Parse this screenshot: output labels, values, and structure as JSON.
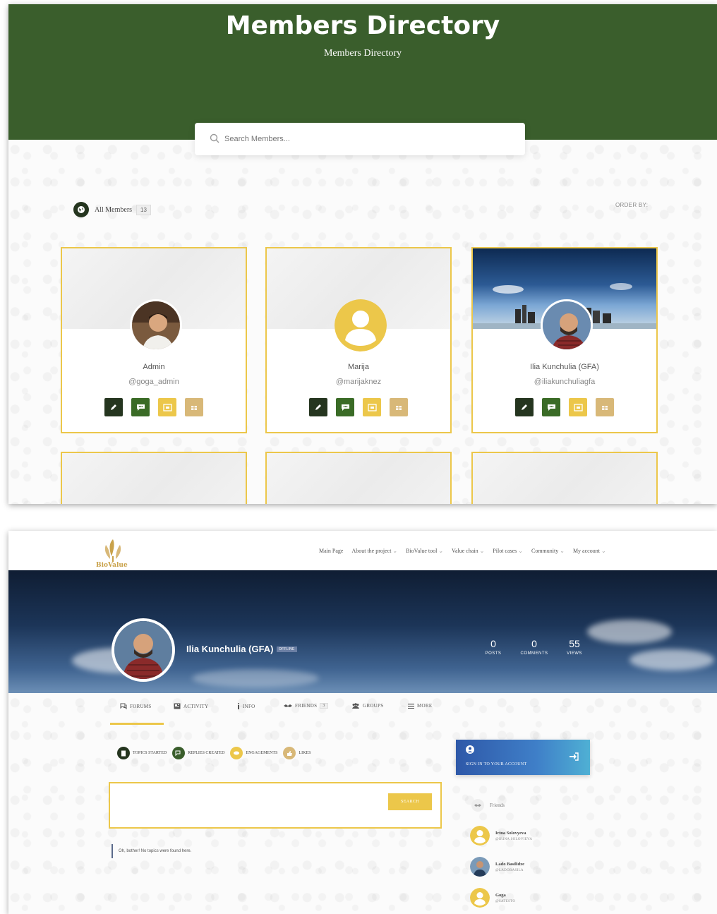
{
  "directory": {
    "title": "Members Directory",
    "subtitle": "Members Directory",
    "search_placeholder": "Search Members...",
    "all_members_label": "All Members",
    "all_members_count": "13",
    "order_by_label": "ORDER BY:",
    "members": [
      {
        "name": "Admin",
        "handle": "@goga_admin",
        "avatar": "photo-avatar",
        "cover": "pattern"
      },
      {
        "name": "Marija",
        "handle": "@marijaknez",
        "avatar": "placeholder-avatar",
        "cover": "pattern"
      },
      {
        "name": "Ilia Kunchulia (GFA)",
        "handle": "@iliakunchuliagfa",
        "avatar": "photo-avatar",
        "cover": "city-skyline"
      }
    ],
    "card_actions": [
      "edit-icon",
      "message-icon",
      "mail-icon",
      "gift-icon"
    ]
  },
  "profile": {
    "logo_text": "BioValue",
    "nav": [
      {
        "label": "Main Page",
        "dropdown": false
      },
      {
        "label": "About the project",
        "dropdown": true
      },
      {
        "label": "BioValue tool",
        "dropdown": true
      },
      {
        "label": "Value chain",
        "dropdown": true
      },
      {
        "label": "Pilot cases",
        "dropdown": true
      },
      {
        "label": "Community",
        "dropdown": true
      },
      {
        "label": "My account",
        "dropdown": true
      }
    ],
    "user_name": "Ilia Kunchulia (GFA)",
    "status_badge": "OFFLINE",
    "stats": [
      {
        "value": "0",
        "label": "POSTS"
      },
      {
        "value": "0",
        "label": "COMMENTS"
      },
      {
        "value": "55",
        "label": "VIEWS"
      }
    ],
    "tabs": [
      {
        "label": "FORUMS",
        "icon": "forums-icon",
        "count": ""
      },
      {
        "label": "ACTIVITY",
        "icon": "activity-icon",
        "count": ""
      },
      {
        "label": "INFO",
        "icon": "info-icon",
        "count": ""
      },
      {
        "label": "FRIENDS",
        "icon": "friends-icon",
        "count": "3"
      },
      {
        "label": "GROUPS",
        "icon": "groups-icon",
        "count": ""
      },
      {
        "label": "MORE",
        "icon": "more-icon",
        "count": ""
      }
    ],
    "active_tab": "FORUMS",
    "forum_filters": [
      {
        "label": "TOPICS STARTED",
        "color": "#25351f"
      },
      {
        "label": "REPLIES CREATED",
        "color": "#3a5e2c"
      },
      {
        "label": "ENGAGEMENTS",
        "color": "#ecc74a"
      },
      {
        "label": "LIKES",
        "color": "#d8b878"
      }
    ],
    "search_button": "SEARCH",
    "notice_text": "Oh, bother! No topics were found here.",
    "signin_label": "SIGN IN TO YOUR ACCOUNT",
    "friends_heading": "Friends",
    "friends": [
      {
        "name": "Irina Solovyeva",
        "handle": "@IRINA SOLOVIEVA",
        "avatar": "placeholder-avatar"
      },
      {
        "name": "Lado Basilidze",
        "handle": "@LADOBASILA",
        "avatar": "photo-avatar"
      },
      {
        "name": "Goga",
        "handle": "@SATESTO",
        "avatar": "placeholder-avatar"
      }
    ]
  },
  "colors": {
    "brand_green": "#3a5e2c",
    "dark_green": "#25351f",
    "accent_yellow": "#ecc74a",
    "tan": "#d8b878"
  }
}
